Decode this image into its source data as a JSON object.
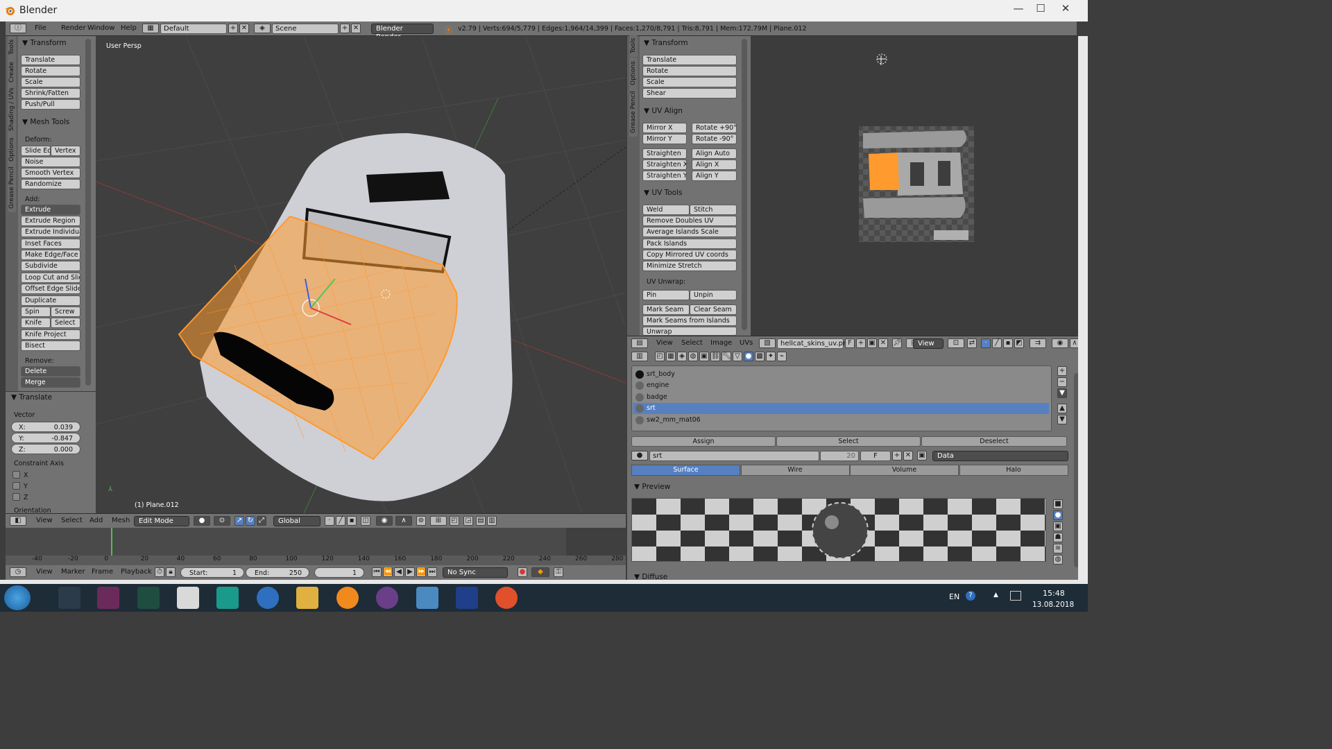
{
  "window": {
    "title": "Blender"
  },
  "topbar": {
    "menus": [
      "File",
      "Render",
      "Window",
      "Help"
    ],
    "layout": "Default",
    "scene": "Scene",
    "engine": "Blender Render",
    "stats": "v2.79 | Verts:694/5,779 | Edges:1,964/14,399 | Faces:1,270/8,791 | Tris:8,791 | Mem:172.79M | Plane.012"
  },
  "left_tabs": [
    "Tools",
    "Create",
    "Shading / UVs",
    "Options",
    "Grease Pencil"
  ],
  "tool_panel": {
    "transform": {
      "header": "Transform",
      "buttons": [
        "Translate",
        "Rotate",
        "Scale",
        "Shrink/Fatten",
        "Push/Pull"
      ]
    },
    "mesh_tools": {
      "header": "Mesh Tools",
      "deform_label": "Deform:",
      "slide_edge": "Slide Ed",
      "vertex": "Vertex",
      "noise": "Noise",
      "smooth_vertex": "Smooth Vertex",
      "randomize": "Randomize",
      "add_label": "Add:",
      "extrude": "Extrude",
      "add_buttons": [
        "Extrude Region",
        "Extrude Individual",
        "Inset Faces",
        "Make Edge/Face",
        "Subdivide",
        "Loop Cut and Slide",
        "Offset Edge Slide",
        "Duplicate"
      ],
      "spin": "Spin",
      "screw": "Screw",
      "knife": "Knife",
      "select": "Select",
      "knife_project": "Knife Project",
      "bisect": "Bisect",
      "remove_label": "Remove:",
      "delete": "Delete",
      "merge": "Merge"
    },
    "operator": {
      "header": "Translate",
      "vector_label": "Vector",
      "x_label": "X:",
      "x": "0.039",
      "y_label": "Y:",
      "y": "-0.847",
      "z_label": "Z:",
      "z": "0.000",
      "constraint_label": "Constraint Axis",
      "axes": [
        "X",
        "Y",
        "Z"
      ],
      "orientation_label": "Orientation"
    }
  },
  "viewport": {
    "label": "User Persp",
    "object_label": "(1) Plane.012"
  },
  "view_header": {
    "menus": [
      "View",
      "Select",
      "Add",
      "Mesh"
    ],
    "mode": "Edit Mode",
    "orientation": "Global"
  },
  "timeline": {
    "ticks": [
      "-40",
      "-20",
      "0",
      "20",
      "40",
      "60",
      "80",
      "100",
      "120",
      "140",
      "160",
      "180",
      "200",
      "220",
      "240",
      "260",
      "280"
    ],
    "menus": [
      "View",
      "Marker",
      "Frame",
      "Playback"
    ],
    "start_label": "Start:",
    "start": "1",
    "end_label": "End:",
    "end": "250",
    "current": "1",
    "sync": "No Sync"
  },
  "uv_tabs": [
    "Tools",
    "Options",
    "Grease Pencil"
  ],
  "uv_panel": {
    "transform": {
      "header": "Transform",
      "buttons": [
        "Translate",
        "Rotate",
        "Scale",
        "Shear"
      ]
    },
    "uv_align": {
      "header": "UV Align",
      "rows": [
        [
          "Mirror X",
          "Rotate +90°"
        ],
        [
          "Mirror Y",
          "Rotate  -90°"
        ],
        [
          "Straighten",
          "Align Auto"
        ],
        [
          "Straighten X",
          "Align X"
        ],
        [
          "Straighten Y",
          "Align Y"
        ]
      ]
    },
    "uv_tools": {
      "header": "UV Tools",
      "weld": "Weld",
      "stitch": "Stitch",
      "buttons": [
        "Remove Doubles UV",
        "Average Islands Scale",
        "Pack Islands",
        "Copy Mirrored UV coords",
        "Minimize Stretch"
      ],
      "unwrap_label": "UV Unwrap:",
      "pin": "Pin",
      "unpin": "Unpin",
      "mark_seam": "Mark Seam",
      "clear_seam": "Clear Seam",
      "mark_seams_islands": "Mark Seams from Islands",
      "unwrap": "Unwrap"
    }
  },
  "uv_header": {
    "menus": [
      "View",
      "Select",
      "Image",
      "UVs"
    ],
    "image": "hellcat_skins_uv.png",
    "fake": "F",
    "view": "View"
  },
  "materials": {
    "slots": [
      "srt_body",
      "engine",
      "badge",
      "srt",
      "sw2_mm_mat06"
    ],
    "selected_index": 3,
    "assign": "Assign",
    "select": "Select",
    "deselect": "Deselect",
    "name": "srt",
    "users": "20",
    "fake": "F",
    "data": "Data",
    "tabs": [
      "Surface",
      "Wire",
      "Volume",
      "Halo"
    ],
    "preview_label": "Preview",
    "diffuse_label": "Diffuse"
  },
  "taskbar": {
    "lang": "EN",
    "time": "15:48",
    "date": "13.08.2018"
  },
  "colors": {
    "accent": "#5680c2",
    "selection": "#ff9a2e",
    "panel": "#727272"
  }
}
